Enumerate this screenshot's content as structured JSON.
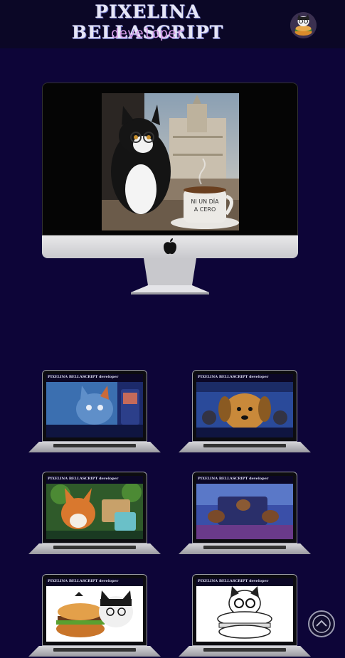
{
  "header": {
    "title": "PIXELINA BELLASCRIPT",
    "subtitle": "developer",
    "avatar_icon": "cat-burger-avatar-icon"
  },
  "hero": {
    "monitor_icon": "imac-monitor-icon",
    "mug_text": "NI UN DÍA A CERO"
  },
  "projects": [
    {
      "bar_title": "PIXELINA BELLASCRIPT developer",
      "theme": "blue-cat"
    },
    {
      "bar_title": "PIXELINA BELLASCRIPT developer",
      "theme": "dog"
    },
    {
      "bar_title": "PIXELINA BELLASCRIPT developer",
      "theme": "fox"
    },
    {
      "bar_title": "PIXELINA BELLASCRIPT developer",
      "theme": "otters"
    },
    {
      "bar_title": "PIXELINA BELLASCRIPT developer",
      "theme": "cat-burger-color"
    },
    {
      "bar_title": "PIXELINA BELLASCRIPT developer",
      "theme": "cat-burger-sketch"
    }
  ],
  "colors": {
    "background": "#0d0538",
    "header": "#0b0726",
    "subtitle": "#d59ce6"
  },
  "scroll_top_icon": "chevron-up-icon"
}
